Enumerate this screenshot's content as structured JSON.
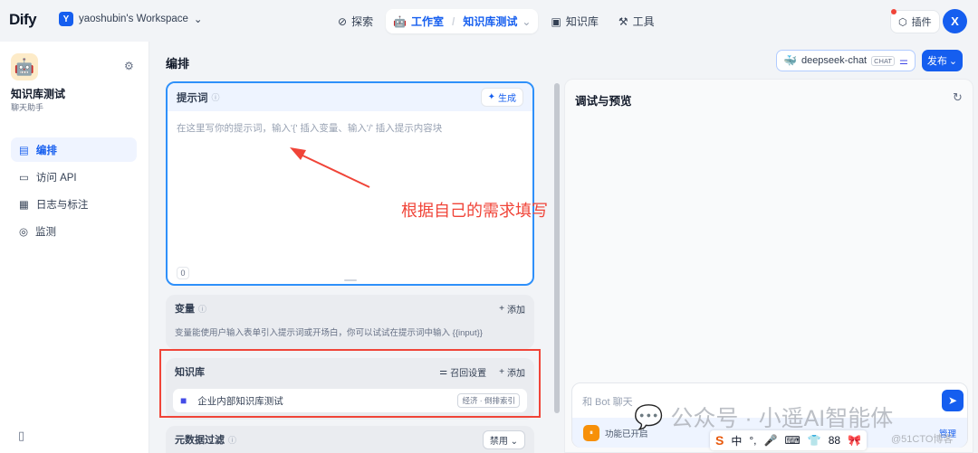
{
  "topnav": {
    "logo_text": "Dify",
    "workspace_badge": "Y",
    "workspace_name": "yaoshubin's Workspace",
    "items": [
      {
        "label": "探索"
      },
      {
        "label": "工作室",
        "sub": "知识库测试"
      },
      {
        "label": "知识库"
      },
      {
        "label": "工具"
      }
    ],
    "plugin_label": "插件",
    "avatar_initial": "X"
  },
  "sidebar": {
    "app_name": "知识库测试",
    "app_type": "聊天助手",
    "menu": [
      {
        "label": "编排",
        "icon": "layout-icon"
      },
      {
        "label": "访问 API",
        "icon": "terminal-icon"
      },
      {
        "label": "日志与标注",
        "icon": "file-icon"
      },
      {
        "label": "监测",
        "icon": "gauge-icon"
      }
    ]
  },
  "editor": {
    "title": "编排",
    "prompt": {
      "label": "提示词",
      "generate_label": "生成",
      "placeholder": "在这里写你的提示词，输入'{' 插入变量、输入'/' 插入提示内容块",
      "char_count": "0"
    },
    "variables": {
      "label": "变量",
      "add_label": "添加",
      "description": "变量能使用户输入表单引入提示词或开场白，你可以试试在提示词中输入 {{input}}"
    },
    "knowledge": {
      "label": "知识库",
      "recall_label": "召回设置",
      "add_label": "添加",
      "items": [
        {
          "name": "企业内部知识库测试",
          "tag": "经济 · 倒排索引"
        }
      ]
    },
    "metadata": {
      "label": "元数据过滤",
      "value": "禁用"
    },
    "annotation": "根据自己的需求填写"
  },
  "header_actions": {
    "model_name": "deepseek-chat",
    "model_mode": "CHAT",
    "publish_label": "发布"
  },
  "debug": {
    "title": "调试与预览",
    "input_placeholder": "和 Bot 聊天",
    "feature_text": "功能已开启",
    "manage_label": "管理"
  },
  "overlay": {
    "watermark": "公众号 · 小遥AI智能体",
    "ime_items": [
      "S",
      "中",
      "°,",
      "🎤",
      "⌨",
      "👕",
      "88",
      "🎀"
    ],
    "blog_mark": "@51CTO博客"
  },
  "colors": {
    "accent": "#155eef",
    "annotation_red": "#f04438",
    "prompt_border": "#2e90fa"
  }
}
